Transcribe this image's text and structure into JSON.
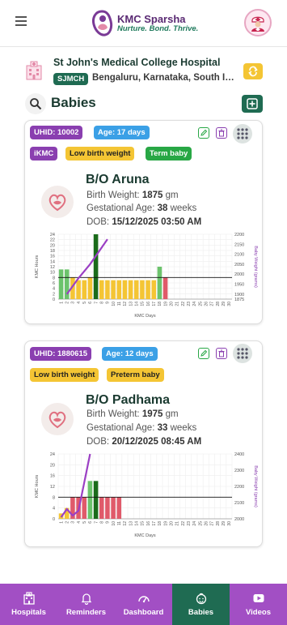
{
  "app": {
    "title": "KMC Sparsha",
    "tagline": "Nurture. Bond. Thrive."
  },
  "hospital": {
    "name": "St John's Medical College Hospital",
    "code": "SJMCH",
    "location": "Bengaluru, Karnataka, South In..."
  },
  "section": {
    "title": "Babies"
  },
  "babies": [
    {
      "uhid": "UHID: 10002",
      "age": "Age: 17 days",
      "tags": [
        "iKMC",
        "Low birth weight",
        "Term baby"
      ],
      "name": "B/O Aruna",
      "birth_weight_label": "Birth Weight:",
      "birth_weight": "1875",
      "weight_unit": "gm",
      "gestational_label": "Gestational Age:",
      "gestational_age": "38",
      "gestational_unit": "weeks",
      "dob_label": "DOB:",
      "dob": "15/12/2025 03:50 AM"
    },
    {
      "uhid": "UHID: 1880615",
      "age": "Age: 12 days",
      "tags": [
        "Low birth weight",
        "Preterm baby"
      ],
      "name": "B/O Padhama",
      "birth_weight_label": "Birth Weight:",
      "birth_weight": "1975",
      "weight_unit": "gm",
      "gestational_label": "Gestational Age:",
      "gestational_age": "33",
      "gestational_unit": "weeks",
      "dob_label": "DOB:",
      "dob": "20/12/2025 08:45 AM"
    }
  ],
  "chart_data": [
    {
      "type": "bar",
      "xlabel": "KMC Days",
      "ylabel": "KMC Hours",
      "y2label": "Baby Weight (grams)",
      "categories": [
        "1",
        "2",
        "3",
        "4",
        "5",
        "6",
        "7",
        "8",
        "9",
        "10",
        "11",
        "12",
        "13",
        "14",
        "15",
        "16",
        "17",
        "18",
        "19",
        "20",
        "21",
        "22",
        "23",
        "24",
        "25",
        "26",
        "27",
        "28",
        "29",
        "30"
      ],
      "ylim": [
        0,
        24
      ],
      "yticks": [
        0,
        2,
        4,
        6,
        8,
        10,
        12,
        14,
        16,
        18,
        20,
        22,
        24
      ],
      "y2lim": [
        1875,
        2200
      ],
      "y2ticks": [
        1875,
        1900,
        1950,
        2000,
        2050,
        2100,
        2150,
        2200
      ],
      "target_line": 8,
      "series": [
        {
          "values": [
            11,
            11,
            8,
            7,
            7,
            8,
            24,
            7,
            7,
            7,
            7,
            7,
            7,
            7,
            7,
            7,
            7,
            12,
            8
          ],
          "colors": [
            "#6cc36c",
            "#6cc36c",
            "#f4c534",
            "#f4c534",
            "#f4c534",
            "#f4c534",
            "#1a6b1a",
            "#f4c534",
            "#f4c534",
            "#f4c534",
            "#f4c534",
            "#f4c534",
            "#f4c534",
            "#f4c534",
            "#f4c534",
            "#f4c534",
            "#f4c534",
            "#6cc36c",
            "#e05a6a"
          ]
        }
      ],
      "weight_line": {
        "color": "#9b3fc4",
        "points": [
          [
            2,
            1900
          ],
          [
            4,
            1980
          ],
          [
            6,
            2050
          ],
          [
            9,
            2175
          ]
        ]
      },
      "grid": true
    },
    {
      "type": "bar",
      "xlabel": "KMC Days",
      "ylabel": "KMC Hours",
      "y2label": "Baby Weight (grams)",
      "categories": [
        "1",
        "2",
        "3",
        "4",
        "5",
        "6",
        "7",
        "8",
        "9",
        "10",
        "11",
        "12",
        "13",
        "14",
        "15",
        "16",
        "17",
        "18",
        "19",
        "20",
        "21",
        "22",
        "23",
        "24",
        "25",
        "26",
        "27",
        "28",
        "29",
        "30"
      ],
      "ylim": [
        0,
        24
      ],
      "yticks": [
        0,
        4,
        8,
        12,
        16,
        20,
        24
      ],
      "y2lim": [
        2000,
        2400
      ],
      "y2ticks": [
        2000,
        2100,
        2200,
        2300,
        2400
      ],
      "target_line": 8,
      "series": [
        {
          "values": [
            2,
            4,
            8,
            8,
            8,
            14,
            14,
            8,
            8,
            8,
            8
          ],
          "colors": [
            "#f4c534",
            "#f4c534",
            "#e05a6a",
            "#e05a6a",
            "#e05a6a",
            "#6cc36c",
            "#1a6b1a",
            "#e05a6a",
            "#e05a6a",
            "#e05a6a",
            "#e05a6a"
          ]
        }
      ],
      "weight_line": {
        "color": "#9b3fc4",
        "points": [
          [
            1,
            2010
          ],
          [
            2,
            2060
          ],
          [
            3,
            2020
          ],
          [
            4,
            2050
          ],
          [
            6,
            2400
          ]
        ]
      },
      "grid": true
    }
  ],
  "nav": {
    "items": [
      {
        "label": "Hospitals",
        "icon": "hospital-icon"
      },
      {
        "label": "Reminders",
        "icon": "bell-icon"
      },
      {
        "label": "Dashboard",
        "icon": "dashboard-icon"
      },
      {
        "label": "Babies",
        "icon": "baby-icon"
      },
      {
        "label": "Videos",
        "icon": "video-icon"
      }
    ],
    "active": "Babies"
  },
  "colors": {
    "primary": "#1f6b52",
    "accent": "#a24fc4",
    "brand_purple": "#5a2a73"
  }
}
